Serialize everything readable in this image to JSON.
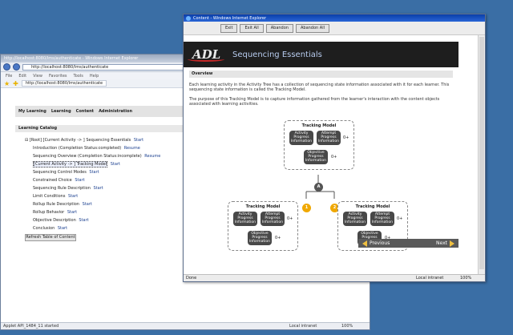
{
  "back_window": {
    "title": "http://localhost:8080/lms/authenticate - Windows Internet Explorer",
    "address": "http://localhost:8080/lms/authenticate",
    "menu": [
      "File",
      "Edit",
      "View",
      "Favorites",
      "Tools",
      "Help"
    ],
    "favorites_url": "http://localhost:8080/lms/authenticate",
    "nav": [
      "My Learning",
      "Learning",
      "Content",
      "Administration"
    ],
    "catalog_heading": "Learning Catalog",
    "catalog_items": [
      {
        "label": "[Root] [Current Activity -> ] Sequencing Essentials",
        "action": "Start"
      },
      {
        "label": "Introduction (Completion Status:completed)",
        "action": "Resume"
      },
      {
        "label": "Sequencing Overview (Completion Status:incomplete)",
        "action": "Resume"
      },
      {
        "label": "[Current Activity -> ] Tracking Model",
        "action": "Start"
      },
      {
        "label": "Sequencing Control Modes",
        "action": "Start"
      },
      {
        "label": "Constrained Choice",
        "action": "Start"
      },
      {
        "label": "Sequencing Rule Description",
        "action": "Start"
      },
      {
        "label": "Limit Conditions",
        "action": "Start"
      },
      {
        "label": "Rollup Rule Description",
        "action": "Start"
      },
      {
        "label": "Rollup Behavior",
        "action": "Start"
      },
      {
        "label": "Objective Description",
        "action": "Start"
      },
      {
        "label": "Conclusion",
        "action": "Start"
      }
    ],
    "refresh_label": "Refresh Table of Content",
    "status": "Applet API_1484_11 started",
    "zone": "Local intranet",
    "zoom": "100%"
  },
  "front_window": {
    "title": "Content - Windows Internet Explorer",
    "buttons": [
      "Exit",
      "Exit All",
      "Abandon",
      "Abandon All"
    ],
    "logo_text": "ADL",
    "banner_title": "Sequencing Essentials",
    "overview_heading": "Overview",
    "paragraph_1": "Each learning activity in the Activity Tree has a collection of sequencing state information associated with it for each learner. This sequencing state information is called the Tracking Model.",
    "paragraph_2": "The purpose of this Tracking Model is to capture information gathered from the learner's interaction with the content objects associated with learning activities.",
    "diagram": {
      "box_title": "Tracking Model",
      "activity": "Activity Progress Information",
      "attempt": "Attempt Progress Information",
      "objective": "Objective Progress Information",
      "multiplicity": "0+",
      "root_badge": "A",
      "left_badge": "1",
      "right_badge": "2"
    },
    "previous_label": "Previous",
    "next_label": "Next",
    "status": "Done",
    "zone": "Local intranet",
    "zoom": "100%"
  },
  "colors": {
    "desktop": "#3a6ea5",
    "badge_gold": "#f0a800",
    "badge_dark": "#555555",
    "banner": "#1e1e1e"
  }
}
